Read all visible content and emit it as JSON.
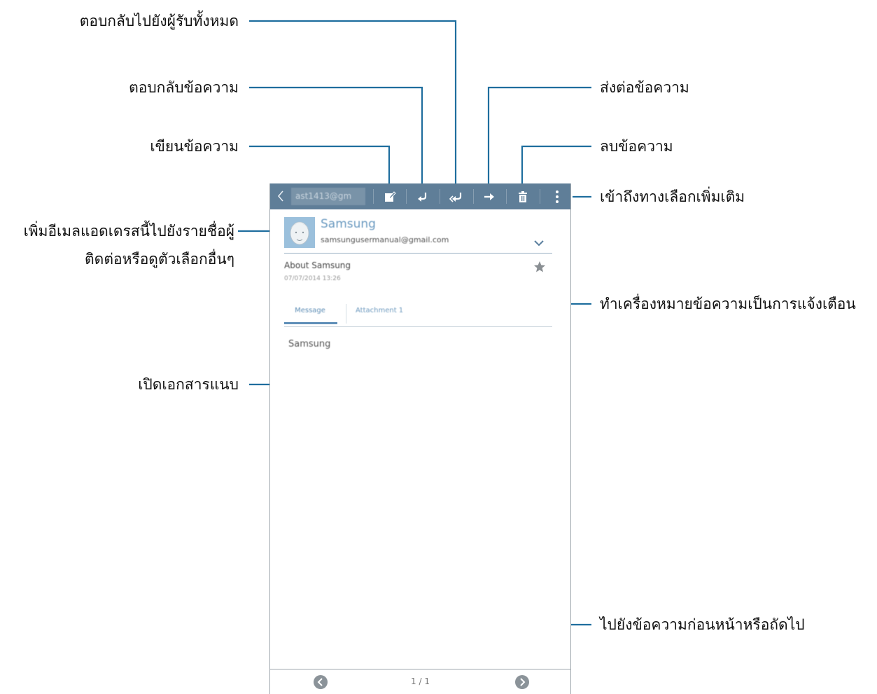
{
  "callouts": {
    "reply_all": "ตอบกลับไปยังผู้รับทั้งหมด",
    "reply": "ตอบกลับข้อความ",
    "compose": "เขียนข้อความ",
    "forward": "ส่งต่อข้อความ",
    "delete": "ลบข้อความ",
    "more_options": "เข้าถึงทางเลือกเพิ่มเติม",
    "add_contact_line1": "เพิ่มอีเมลแอดเดรสนี้ไปยังรายชื่อผู้",
    "add_contact_line2": "ติดต่อหรือดูตัวเลือกอื่นๆ",
    "mark_reminder": "ทำเครื่องหมายข้อความเป็นการแจ้งเตือน",
    "open_attachment": "เปิดเอกสารแนบ",
    "prev_next": "ไปยังข้อความก่อนหน้าหรือถัดไป"
  },
  "appbar": {
    "account": "ast1413@gm",
    "icons": [
      "back-icon",
      "compose-icon",
      "reply-icon",
      "reply-all-icon",
      "forward-icon",
      "delete-icon",
      "more-icon"
    ]
  },
  "message": {
    "sender_name": "Samsung",
    "sender_email": "samsungusermanual@gmail.com",
    "subject": "About Samsung",
    "datetime": "07/07/2014 13:26",
    "tabs": [
      "Message",
      "Attachment 1"
    ],
    "body": "Samsung"
  },
  "footer": {
    "page_indicator": "1 / 1"
  },
  "colors": {
    "appbar": "#5f7e98",
    "accent": "#5f8fb8",
    "leader_line": "#1f6e9e"
  }
}
